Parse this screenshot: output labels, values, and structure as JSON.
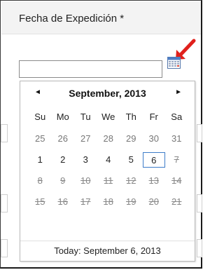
{
  "field": {
    "label": "Fecha de Expedición *",
    "value": ""
  },
  "icons": {
    "calendar": "calendar-icon",
    "arrow": "red-arrow-icon",
    "arrow_color": "#e0201c"
  },
  "calendar": {
    "month_title": "September, 2013",
    "prev_label": "◄",
    "next_label": "►",
    "weekdays": [
      "Su",
      "Mo",
      "Tu",
      "We",
      "Th",
      "Fr",
      "Sa"
    ],
    "weeks": [
      [
        {
          "d": "25",
          "s": "other"
        },
        {
          "d": "26",
          "s": "other"
        },
        {
          "d": "27",
          "s": "other"
        },
        {
          "d": "28",
          "s": "other"
        },
        {
          "d": "29",
          "s": "other"
        },
        {
          "d": "30",
          "s": "other"
        },
        {
          "d": "31",
          "s": "other"
        }
      ],
      [
        {
          "d": "1",
          "s": "normal"
        },
        {
          "d": "2",
          "s": "normal"
        },
        {
          "d": "3",
          "s": "normal"
        },
        {
          "d": "4",
          "s": "normal"
        },
        {
          "d": "5",
          "s": "normal"
        },
        {
          "d": "6",
          "s": "today"
        },
        {
          "d": "7",
          "s": "disabled"
        }
      ],
      [
        {
          "d": "8",
          "s": "disabled"
        },
        {
          "d": "9",
          "s": "disabled"
        },
        {
          "d": "10",
          "s": "disabled"
        },
        {
          "d": "11",
          "s": "disabled"
        },
        {
          "d": "12",
          "s": "disabled"
        },
        {
          "d": "13",
          "s": "disabled"
        },
        {
          "d": "14",
          "s": "disabled"
        }
      ],
      [
        {
          "d": "15",
          "s": "disabled"
        },
        {
          "d": "16",
          "s": "disabled"
        },
        {
          "d": "17",
          "s": "disabled"
        },
        {
          "d": "18",
          "s": "disabled"
        },
        {
          "d": "19",
          "s": "disabled"
        },
        {
          "d": "20",
          "s": "disabled"
        },
        {
          "d": "21",
          "s": "disabled"
        }
      ]
    ],
    "today_label": "Today: September 6, 2013"
  }
}
